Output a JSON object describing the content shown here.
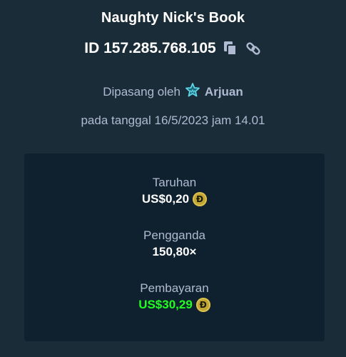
{
  "bet": {
    "game_title": "Naughty Nick's Book",
    "id_text": "ID 157.285.768.105",
    "placed_by_prefix": "Dipasang oleh",
    "username": "Arjuan",
    "date_text": "pada tanggal 16/5/2023 jam 14.01"
  },
  "details": {
    "wager_label": "Taruhan",
    "wager_value": "US$0,20",
    "multiplier_label": "Pengganda",
    "multiplier_value": "150,80×",
    "payout_label": "Pembayaran",
    "payout_value": "US$30,29"
  },
  "icons": {
    "copy": "copy-icon",
    "link": "link-icon",
    "vip": "vip-crown-icon",
    "currency": "dogecoin-icon"
  },
  "currency_symbol": "Ð",
  "colors": {
    "background": "#1a2c38",
    "panel": "#0f212e",
    "muted_text": "#b1bad3",
    "payout_green": "#1fff20",
    "vip_accent": "#5fd4e6",
    "doge_gold": "#c2a633"
  }
}
